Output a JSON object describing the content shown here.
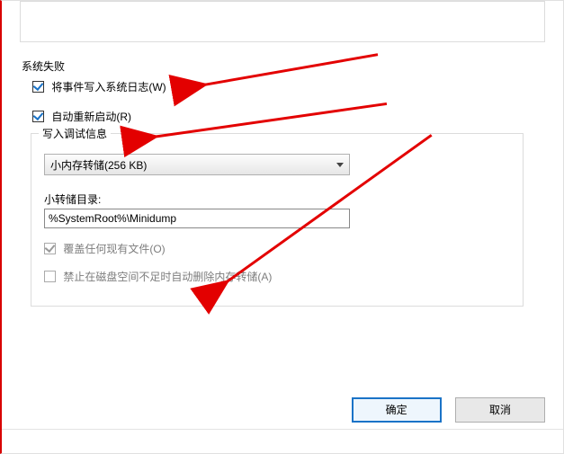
{
  "section": {
    "title": "系统失败"
  },
  "checkboxes": {
    "write_event": {
      "label": "将事件写入系统日志(W)"
    },
    "auto_restart": {
      "label": "自动重新启动(R)"
    },
    "overwrite": {
      "label": "覆盖任何现有文件(O)"
    },
    "no_auto_delete": {
      "label": "禁止在磁盘空间不足时自动删除内存转储(A)"
    }
  },
  "group": {
    "legend": "写入调试信息",
    "dump_type_selected": "小内存转储(256 KB)",
    "dir_label": "小转储目录:",
    "dir_value": "%SystemRoot%\\Minidump"
  },
  "buttons": {
    "ok": "确定",
    "cancel": "取消"
  }
}
